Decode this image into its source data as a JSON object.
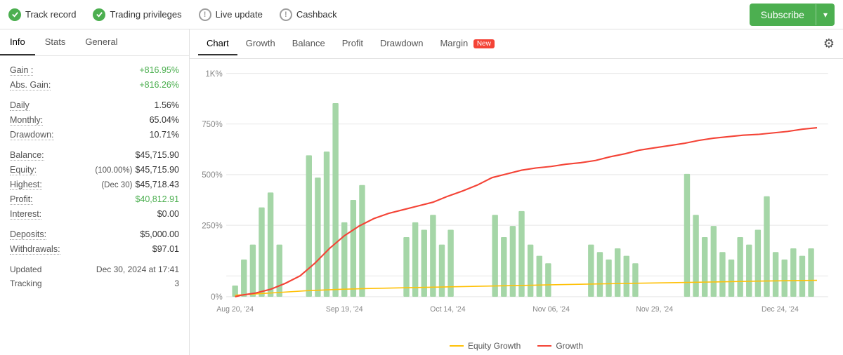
{
  "topbar": {
    "items": [
      {
        "id": "track-record",
        "label": "Track record",
        "icon": "check-green"
      },
      {
        "id": "trading-privileges",
        "label": "Trading privileges",
        "icon": "check-green"
      },
      {
        "id": "live-update",
        "label": "Live update",
        "icon": "exclaim-gray"
      },
      {
        "id": "cashback",
        "label": "Cashback",
        "icon": "exclaim-gray"
      }
    ],
    "subscribe_label": "Subscribe"
  },
  "left_panel": {
    "tabs": [
      {
        "id": "info",
        "label": "Info",
        "active": true
      },
      {
        "id": "stats",
        "label": "Stats",
        "active": false
      },
      {
        "id": "general",
        "label": "General",
        "active": false
      }
    ],
    "stats": {
      "gain_label": "Gain :",
      "gain_value": "+816.95%",
      "abs_gain_label": "Abs. Gain:",
      "abs_gain_value": "+816.26%",
      "daily_label": "Daily",
      "daily_value": "1.56%",
      "monthly_label": "Monthly:",
      "monthly_value": "65.04%",
      "drawdown_label": "Drawdown:",
      "drawdown_value": "10.71%",
      "balance_label": "Balance:",
      "balance_value": "$45,715.90",
      "equity_label": "Equity:",
      "equity_pct": "(100.00%)",
      "equity_value": "$45,715.90",
      "highest_label": "Highest:",
      "highest_date": "(Dec 30)",
      "highest_value": "$45,718.43",
      "profit_label": "Profit:",
      "profit_value": "$40,812.91",
      "interest_label": "Interest:",
      "interest_value": "$0.00",
      "deposits_label": "Deposits:",
      "deposits_value": "$5,000.00",
      "withdrawals_label": "Withdrawals:",
      "withdrawals_value": "$97.01",
      "updated_label": "Updated",
      "updated_value": "Dec 30, 2024 at 17:41",
      "tracking_label": "Tracking",
      "tracking_value": "3"
    }
  },
  "chart_panel": {
    "tabs": [
      {
        "id": "chart",
        "label": "Chart",
        "active": true
      },
      {
        "id": "growth",
        "label": "Growth",
        "active": false
      },
      {
        "id": "balance",
        "label": "Balance",
        "active": false
      },
      {
        "id": "profit",
        "label": "Profit",
        "active": false
      },
      {
        "id": "drawdown",
        "label": "Drawdown",
        "active": false
      },
      {
        "id": "margin",
        "label": "Margin",
        "active": false,
        "badge": "New"
      }
    ],
    "y_labels": [
      "1K%",
      "750%",
      "500%",
      "250%",
      "0%"
    ],
    "x_labels": [
      "Aug 20, '24",
      "Sep 19, '24",
      "Oct 14, '24",
      "Nov 06, '24",
      "Nov 29, '24",
      "Dec 24, '24"
    ],
    "legend": {
      "equity_label": "Equity Growth",
      "growth_label": "Growth"
    }
  }
}
